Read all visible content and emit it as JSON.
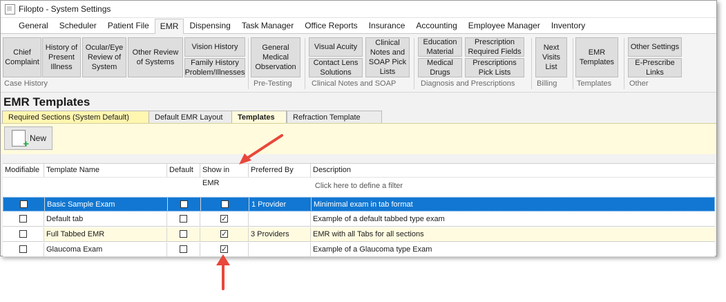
{
  "window": {
    "title": "Filopto - System Settings"
  },
  "menu": [
    "General",
    "Scheduler",
    "Patient File",
    "EMR",
    "Dispensing",
    "Task Manager",
    "Office Reports",
    "Insurance",
    "Accounting",
    "Employee Manager",
    "Inventory"
  ],
  "menu_active": "EMR",
  "ribbon": {
    "buttons": [
      "Chief Complaint",
      "History of Present Illness",
      "Ocular/Eye Review of System",
      "Other Review of Systems",
      "Vision History",
      "Family History Problem/Illnesses",
      "General Medical Observation",
      "Visual Acuity",
      "Contact Lens Solutions",
      "Clinical Notes and SOAP Pick Lists",
      "Education Material",
      "Prescription Required Fields",
      "Medical Drugs",
      "Prescriptions Pick Lists",
      "Next Visits List",
      "EMR Templates",
      "Other Settings",
      "E-Prescribe Links"
    ],
    "groups": [
      "Case History",
      "Pre-Testing",
      "Clinical Notes and SOAP",
      "Diagnosis and Prescriptions",
      "Billing",
      "Templates",
      "Other"
    ]
  },
  "page": {
    "title": "EMR Templates"
  },
  "tabs": [
    "Required Sections (System Default)",
    "Default EMR Layout",
    "Templates",
    "Refraction Template"
  ],
  "tabs_active": "Templates",
  "toolbar": {
    "new_label": "New"
  },
  "grid": {
    "columns": [
      "Modifiable",
      "Template Name",
      "Default",
      "Show in EMR",
      "Preferred By",
      "Description"
    ],
    "filter_text": "Click here to define a filter",
    "rows": [
      {
        "modifiable": false,
        "name": "Basic Sample Exam",
        "default": false,
        "show_in_emr": false,
        "preferred_by": "1 Provider",
        "description": "Minimimal exam in tab format",
        "selected": true
      },
      {
        "modifiable": false,
        "name": "Default tab",
        "default": false,
        "show_in_emr": true,
        "preferred_by": "",
        "description": "Example of a default tabbed type exam",
        "selected": false
      },
      {
        "modifiable": false,
        "name": "Full Tabbed EMR",
        "default": false,
        "show_in_emr": true,
        "preferred_by": "3 Providers",
        "description": "EMR with all Tabs for all sections",
        "selected": false
      },
      {
        "modifiable": false,
        "name": "Glaucoma Exam",
        "default": false,
        "show_in_emr": true,
        "preferred_by": "",
        "description": "Example of a Glaucoma type Exam",
        "selected": false
      }
    ]
  },
  "colors": {
    "selection": "#1177d2",
    "yellow_panel": "#fffbdc",
    "annotation_arrow": "#e8473a"
  }
}
